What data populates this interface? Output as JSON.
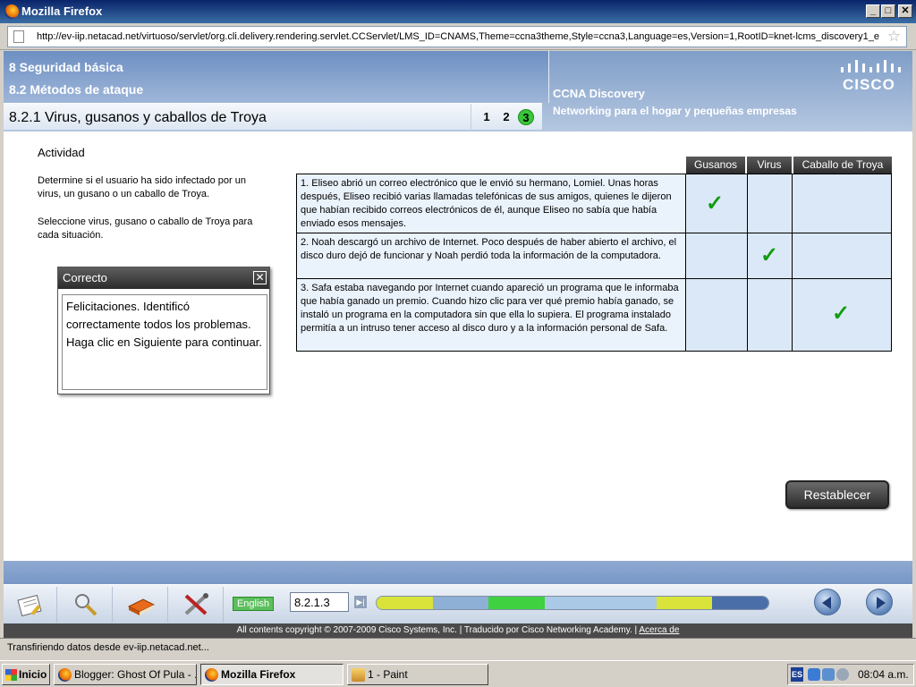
{
  "window": {
    "title": "Mozilla Firefox"
  },
  "browser": {
    "url": "http://ev-iip.netacad.net/virtuoso/servlet/org.cli.delivery.rendering.servlet.CCServlet/LMS_ID=CNAMS,Theme=ccna3theme,Style=ccna3,Language=es,Version=1,RootID=knet-lcms_discovery1_e",
    "status": "Transfiriendo datos desde ev-iip.netacad.net..."
  },
  "header": {
    "chapter": "8 Seguridad básica",
    "section": "8.2 Métodos de ataque",
    "topic": "8.2.1 Virus, gusanos y caballos de Troya",
    "pages": [
      "1",
      "2",
      "3"
    ],
    "current_page": "3",
    "product": "CCNA Discovery",
    "tagline": "Networking para el hogar y pequeñas empresas",
    "logo_text": "CISCO"
  },
  "activity": {
    "title": "Actividad",
    "instruction1": "Determine si el usuario ha sido infectado por un virus, un gusano o un caballo de Troya.",
    "instruction2": "Seleccione virus, gusano o caballo de Troya para cada situación.",
    "columns": [
      "Gusanos",
      "Virus",
      "Caballo de Troya"
    ],
    "rows": [
      {
        "text": "1. Eliseo abrió un correo electrónico que le envió su hermano, Lomiel. Unas horas después, Eliseo recibió varias llamadas telefónicas de sus amigos, quienes le dijeron que habían recibido correos electrónicos de él, aunque Eliseo no sabía que había enviado esos mensajes.",
        "answer": "Gusanos"
      },
      {
        "text": "2. Noah descargó un archivo de Internet. Poco después de haber abierto el archivo, el disco duro dejó de funcionar y Noah perdió toda la información de la computadora.",
        "answer": "Virus"
      },
      {
        "text": "3. Safa estaba navegando por Internet cuando apareció un programa que le informaba que había ganado un premio. Cuando hizo clic para ver qué premio había ganado, se instaló un programa en la computadora sin que ella lo supiera. El programa instalado permitía a un intruso tener acceso al disco duro y a la información personal de Safa.",
        "answer": "Caballo de Troya"
      }
    ],
    "check_glyph": "✓",
    "reset_label": "Restablecer"
  },
  "feedback": {
    "title": "Correcto",
    "close_glyph": "✕",
    "message": "Felicitaciones. Identificó correctamente todos los problemas. Haga clic en Siguiente para continuar."
  },
  "toolbar": {
    "tools": [
      "notepad-icon",
      "magnifier-icon",
      "book-icon",
      "tools-icon"
    ],
    "language_label": "English",
    "page_number": "8.2.1.3",
    "progress_colors": [
      "#d9e33a",
      "#8fb0d6",
      "#3fd13f",
      "#a9c9e6",
      "#a9c9e6",
      "#d9e33a",
      "#4a6ea8"
    ]
  },
  "footer": {
    "copyright": "All contents copyright © 2007-2009 Cisco Systems, Inc. | Traducido por Cisco Networking Academy. |",
    "about_link": "Acerca de"
  },
  "taskbar": {
    "start_label": "Inicio",
    "tasks": [
      {
        "label": "Blogger: Ghost Of Pula - ...",
        "icon": "firefox-icon"
      },
      {
        "label": "Mozilla Firefox",
        "icon": "firefox-icon",
        "active": true
      },
      {
        "label": "1 - Paint",
        "icon": "paint-icon"
      }
    ],
    "language": "ES",
    "clock": "08:04 a.m."
  }
}
